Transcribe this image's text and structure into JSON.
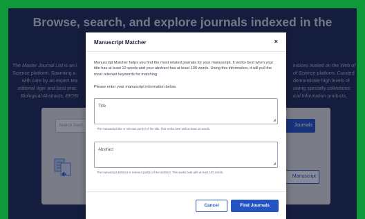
{
  "hero": {
    "title": "Browse, search, and explore journals indexed in the"
  },
  "intro": {
    "l1_a": "The ",
    "l1_b": "Master Journal List",
    "l1_c": " is an i",
    "l1_right_a": "indices hosted on the ",
    "l1_right_b": "Web of",
    "l2_left": "Science platform. Spanning a",
    "l2_right_b": "of Science",
    "l2_right_c": " platform. Curated",
    "l3_left": "with care by an expert tea",
    "l3_right": "demonstrate high levels of",
    "l4_left": "editorial rigor and best prac",
    "l4_right": "owing specialty collections:",
    "l5_left": "Biological Abstracts, BIOSI",
    "l5_right_a": "ical Information",
    "l5_right_b": " products."
  },
  "search": {
    "placeholder": "Search Journ",
    "button": "Journals",
    "matcher_button": "Manuscript"
  },
  "modal": {
    "title": "Manuscript Matcher",
    "close": "×",
    "description": "Manuscript Matcher helps you find the most related journals for your manuscript. It works best when your title has at least 10 words and your abstract has at least 100 words. Using this information, it will pull the most relevant keywords for matching.",
    "instruction": "Please enter your manuscript information below.",
    "title_field": {
      "label": "Title",
      "helper": "The manuscript title or relevant part(s) of the title. This works best with at least 10 words."
    },
    "abstract_field": {
      "label": "Abstract",
      "helper": "The manuscript abstract or relevant part(s) of the abstract. This works best with at least 100 words."
    },
    "cancel": "Cancel",
    "find": "Find Journals"
  }
}
